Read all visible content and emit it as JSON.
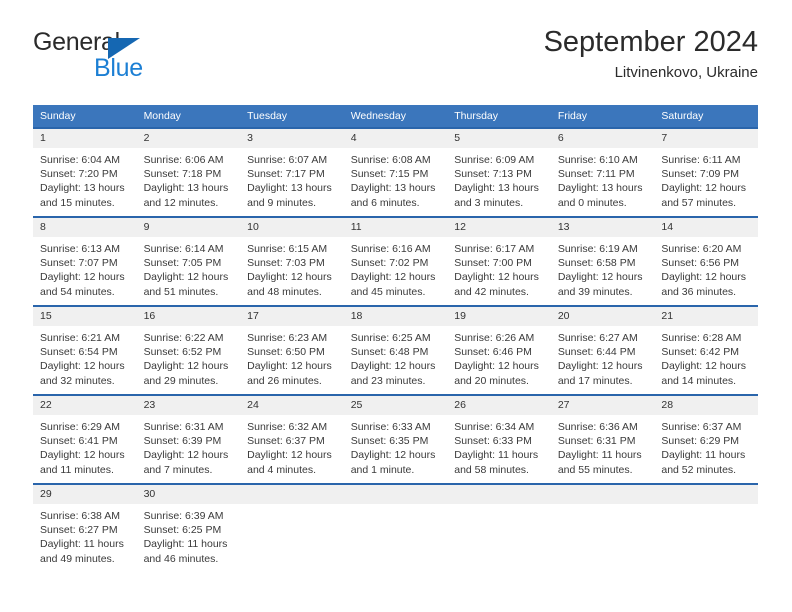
{
  "brand": {
    "name_part1": "General",
    "name_part2": "Blue",
    "triangle_color": "#1567b2",
    "blue_text_color": "#1c7fd4"
  },
  "header": {
    "title": "September 2024",
    "subtitle": "Litvinenkovo, Ukraine"
  },
  "theme": {
    "header_row_bg": "#3b76bc",
    "header_row_text": "#ffffff",
    "row_divider": "#2a65ab",
    "daynum_bg": "#f0f0f0",
    "body_text": "#3a3a3a"
  },
  "weekdays": [
    "Sunday",
    "Monday",
    "Tuesday",
    "Wednesday",
    "Thursday",
    "Friday",
    "Saturday"
  ],
  "weeks": [
    [
      {
        "day": "1",
        "sunrise": "Sunrise: 6:04 AM",
        "sunset": "Sunset: 7:20 PM",
        "daylight1": "Daylight: 13 hours",
        "daylight2": "and 15 minutes."
      },
      {
        "day": "2",
        "sunrise": "Sunrise: 6:06 AM",
        "sunset": "Sunset: 7:18 PM",
        "daylight1": "Daylight: 13 hours",
        "daylight2": "and 12 minutes."
      },
      {
        "day": "3",
        "sunrise": "Sunrise: 6:07 AM",
        "sunset": "Sunset: 7:17 PM",
        "daylight1": "Daylight: 13 hours",
        "daylight2": "and 9 minutes."
      },
      {
        "day": "4",
        "sunrise": "Sunrise: 6:08 AM",
        "sunset": "Sunset: 7:15 PM",
        "daylight1": "Daylight: 13 hours",
        "daylight2": "and 6 minutes."
      },
      {
        "day": "5",
        "sunrise": "Sunrise: 6:09 AM",
        "sunset": "Sunset: 7:13 PM",
        "daylight1": "Daylight: 13 hours",
        "daylight2": "and 3 minutes."
      },
      {
        "day": "6",
        "sunrise": "Sunrise: 6:10 AM",
        "sunset": "Sunset: 7:11 PM",
        "daylight1": "Daylight: 13 hours",
        "daylight2": "and 0 minutes."
      },
      {
        "day": "7",
        "sunrise": "Sunrise: 6:11 AM",
        "sunset": "Sunset: 7:09 PM",
        "daylight1": "Daylight: 12 hours",
        "daylight2": "and 57 minutes."
      }
    ],
    [
      {
        "day": "8",
        "sunrise": "Sunrise: 6:13 AM",
        "sunset": "Sunset: 7:07 PM",
        "daylight1": "Daylight: 12 hours",
        "daylight2": "and 54 minutes."
      },
      {
        "day": "9",
        "sunrise": "Sunrise: 6:14 AM",
        "sunset": "Sunset: 7:05 PM",
        "daylight1": "Daylight: 12 hours",
        "daylight2": "and 51 minutes."
      },
      {
        "day": "10",
        "sunrise": "Sunrise: 6:15 AM",
        "sunset": "Sunset: 7:03 PM",
        "daylight1": "Daylight: 12 hours",
        "daylight2": "and 48 minutes."
      },
      {
        "day": "11",
        "sunrise": "Sunrise: 6:16 AM",
        "sunset": "Sunset: 7:02 PM",
        "daylight1": "Daylight: 12 hours",
        "daylight2": "and 45 minutes."
      },
      {
        "day": "12",
        "sunrise": "Sunrise: 6:17 AM",
        "sunset": "Sunset: 7:00 PM",
        "daylight1": "Daylight: 12 hours",
        "daylight2": "and 42 minutes."
      },
      {
        "day": "13",
        "sunrise": "Sunrise: 6:19 AM",
        "sunset": "Sunset: 6:58 PM",
        "daylight1": "Daylight: 12 hours",
        "daylight2": "and 39 minutes."
      },
      {
        "day": "14",
        "sunrise": "Sunrise: 6:20 AM",
        "sunset": "Sunset: 6:56 PM",
        "daylight1": "Daylight: 12 hours",
        "daylight2": "and 36 minutes."
      }
    ],
    [
      {
        "day": "15",
        "sunrise": "Sunrise: 6:21 AM",
        "sunset": "Sunset: 6:54 PM",
        "daylight1": "Daylight: 12 hours",
        "daylight2": "and 32 minutes."
      },
      {
        "day": "16",
        "sunrise": "Sunrise: 6:22 AM",
        "sunset": "Sunset: 6:52 PM",
        "daylight1": "Daylight: 12 hours",
        "daylight2": "and 29 minutes."
      },
      {
        "day": "17",
        "sunrise": "Sunrise: 6:23 AM",
        "sunset": "Sunset: 6:50 PM",
        "daylight1": "Daylight: 12 hours",
        "daylight2": "and 26 minutes."
      },
      {
        "day": "18",
        "sunrise": "Sunrise: 6:25 AM",
        "sunset": "Sunset: 6:48 PM",
        "daylight1": "Daylight: 12 hours",
        "daylight2": "and 23 minutes."
      },
      {
        "day": "19",
        "sunrise": "Sunrise: 6:26 AM",
        "sunset": "Sunset: 6:46 PM",
        "daylight1": "Daylight: 12 hours",
        "daylight2": "and 20 minutes."
      },
      {
        "day": "20",
        "sunrise": "Sunrise: 6:27 AM",
        "sunset": "Sunset: 6:44 PM",
        "daylight1": "Daylight: 12 hours",
        "daylight2": "and 17 minutes."
      },
      {
        "day": "21",
        "sunrise": "Sunrise: 6:28 AM",
        "sunset": "Sunset: 6:42 PM",
        "daylight1": "Daylight: 12 hours",
        "daylight2": "and 14 minutes."
      }
    ],
    [
      {
        "day": "22",
        "sunrise": "Sunrise: 6:29 AM",
        "sunset": "Sunset: 6:41 PM",
        "daylight1": "Daylight: 12 hours",
        "daylight2": "and 11 minutes."
      },
      {
        "day": "23",
        "sunrise": "Sunrise: 6:31 AM",
        "sunset": "Sunset: 6:39 PM",
        "daylight1": "Daylight: 12 hours",
        "daylight2": "and 7 minutes."
      },
      {
        "day": "24",
        "sunrise": "Sunrise: 6:32 AM",
        "sunset": "Sunset: 6:37 PM",
        "daylight1": "Daylight: 12 hours",
        "daylight2": "and 4 minutes."
      },
      {
        "day": "25",
        "sunrise": "Sunrise: 6:33 AM",
        "sunset": "Sunset: 6:35 PM",
        "daylight1": "Daylight: 12 hours",
        "daylight2": "and 1 minute."
      },
      {
        "day": "26",
        "sunrise": "Sunrise: 6:34 AM",
        "sunset": "Sunset: 6:33 PM",
        "daylight1": "Daylight: 11 hours",
        "daylight2": "and 58 minutes."
      },
      {
        "day": "27",
        "sunrise": "Sunrise: 6:36 AM",
        "sunset": "Sunset: 6:31 PM",
        "daylight1": "Daylight: 11 hours",
        "daylight2": "and 55 minutes."
      },
      {
        "day": "28",
        "sunrise": "Sunrise: 6:37 AM",
        "sunset": "Sunset: 6:29 PM",
        "daylight1": "Daylight: 11 hours",
        "daylight2": "and 52 minutes."
      }
    ],
    [
      {
        "day": "29",
        "sunrise": "Sunrise: 6:38 AM",
        "sunset": "Sunset: 6:27 PM",
        "daylight1": "Daylight: 11 hours",
        "daylight2": "and 49 minutes."
      },
      {
        "day": "30",
        "sunrise": "Sunrise: 6:39 AM",
        "sunset": "Sunset: 6:25 PM",
        "daylight1": "Daylight: 11 hours",
        "daylight2": "and 46 minutes."
      },
      {
        "day": "",
        "sunrise": "",
        "sunset": "",
        "daylight1": "",
        "daylight2": ""
      },
      {
        "day": "",
        "sunrise": "",
        "sunset": "",
        "daylight1": "",
        "daylight2": ""
      },
      {
        "day": "",
        "sunrise": "",
        "sunset": "",
        "daylight1": "",
        "daylight2": ""
      },
      {
        "day": "",
        "sunrise": "",
        "sunset": "",
        "daylight1": "",
        "daylight2": ""
      },
      {
        "day": "",
        "sunrise": "",
        "sunset": "",
        "daylight1": "",
        "daylight2": ""
      }
    ]
  ]
}
